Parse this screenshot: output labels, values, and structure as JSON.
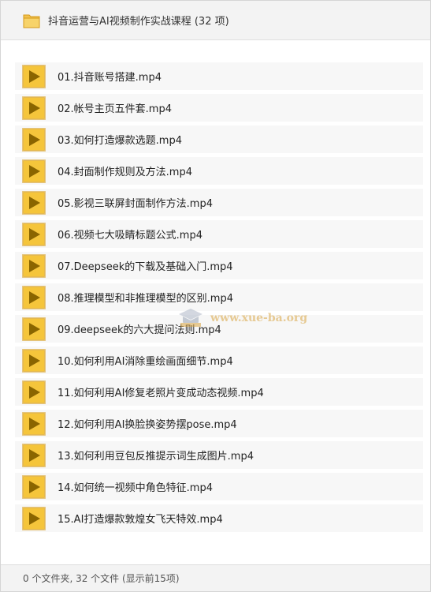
{
  "header": {
    "title": "抖音运营与AI视频制作实战课程 (32 项)"
  },
  "files": [
    {
      "name": "01.抖音账号搭建.mp4"
    },
    {
      "name": "02.帐号主页五件套.mp4"
    },
    {
      "name": "03.如何打造爆款选题.mp4"
    },
    {
      "name": "04.封面制作规则及方法.mp4"
    },
    {
      "name": "05.影视三联屏封面制作方法.mp4"
    },
    {
      "name": "06.视频七大吸睛标题公式.mp4"
    },
    {
      "name": "07.Deepseek的下载及基础入门.mp4"
    },
    {
      "name": "08.推理模型和非推理模型的区别.mp4"
    },
    {
      "name": "09.deepseek的六大提问法则.mp4"
    },
    {
      "name": "10.如何利用AI消除重绘画面细节.mp4"
    },
    {
      "name": "11.如何利用AI修复老照片变成动态视频.mp4"
    },
    {
      "name": "12.如何利用AI换脸换姿势摆pose.mp4"
    },
    {
      "name": "13.如何利用豆包反推提示词生成图片.mp4"
    },
    {
      "name": "14.如何统一视频中角色特征.mp4"
    },
    {
      "name": "15.AI打造爆款敦煌女飞天特效.mp4"
    }
  ],
  "footer": {
    "summary": "0 个文件夹, 32 个文件 (显示前15项)"
  },
  "watermark": {
    "text": "www.xue-ba.org"
  },
  "icons": {
    "folder": "folder-icon",
    "file": "video-file-icon"
  },
  "colors": {
    "folder": "#f2c14e",
    "file_icon_fill": "#f5c53b",
    "file_icon_border": "#d49a1a",
    "play_triangle": "#8a6500",
    "header_bg": "#f3f3f3",
    "row_bg": "#f7f7f7"
  }
}
